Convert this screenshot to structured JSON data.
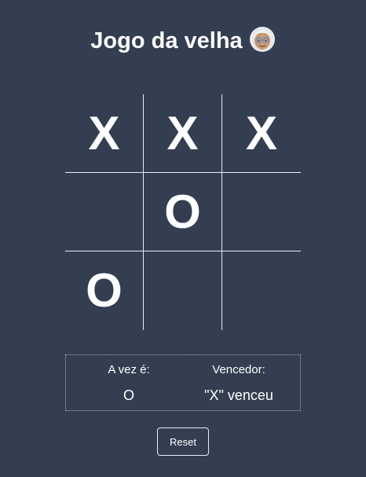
{
  "header": {
    "title": "Jogo da velha",
    "emoji_icon": "old-woman-emoji"
  },
  "board": {
    "cells": [
      "X",
      "X",
      "X",
      "",
      "O",
      "",
      "O",
      "",
      ""
    ]
  },
  "status": {
    "turn_label": "A vez é:",
    "turn_value": "O",
    "winner_label": "Vencedor:",
    "winner_value": "\"X\" venceu"
  },
  "controls": {
    "reset_label": "Reset"
  },
  "colors": {
    "background": "#333e51",
    "foreground": "#ffffff",
    "grid_line": "#e9edf2"
  }
}
